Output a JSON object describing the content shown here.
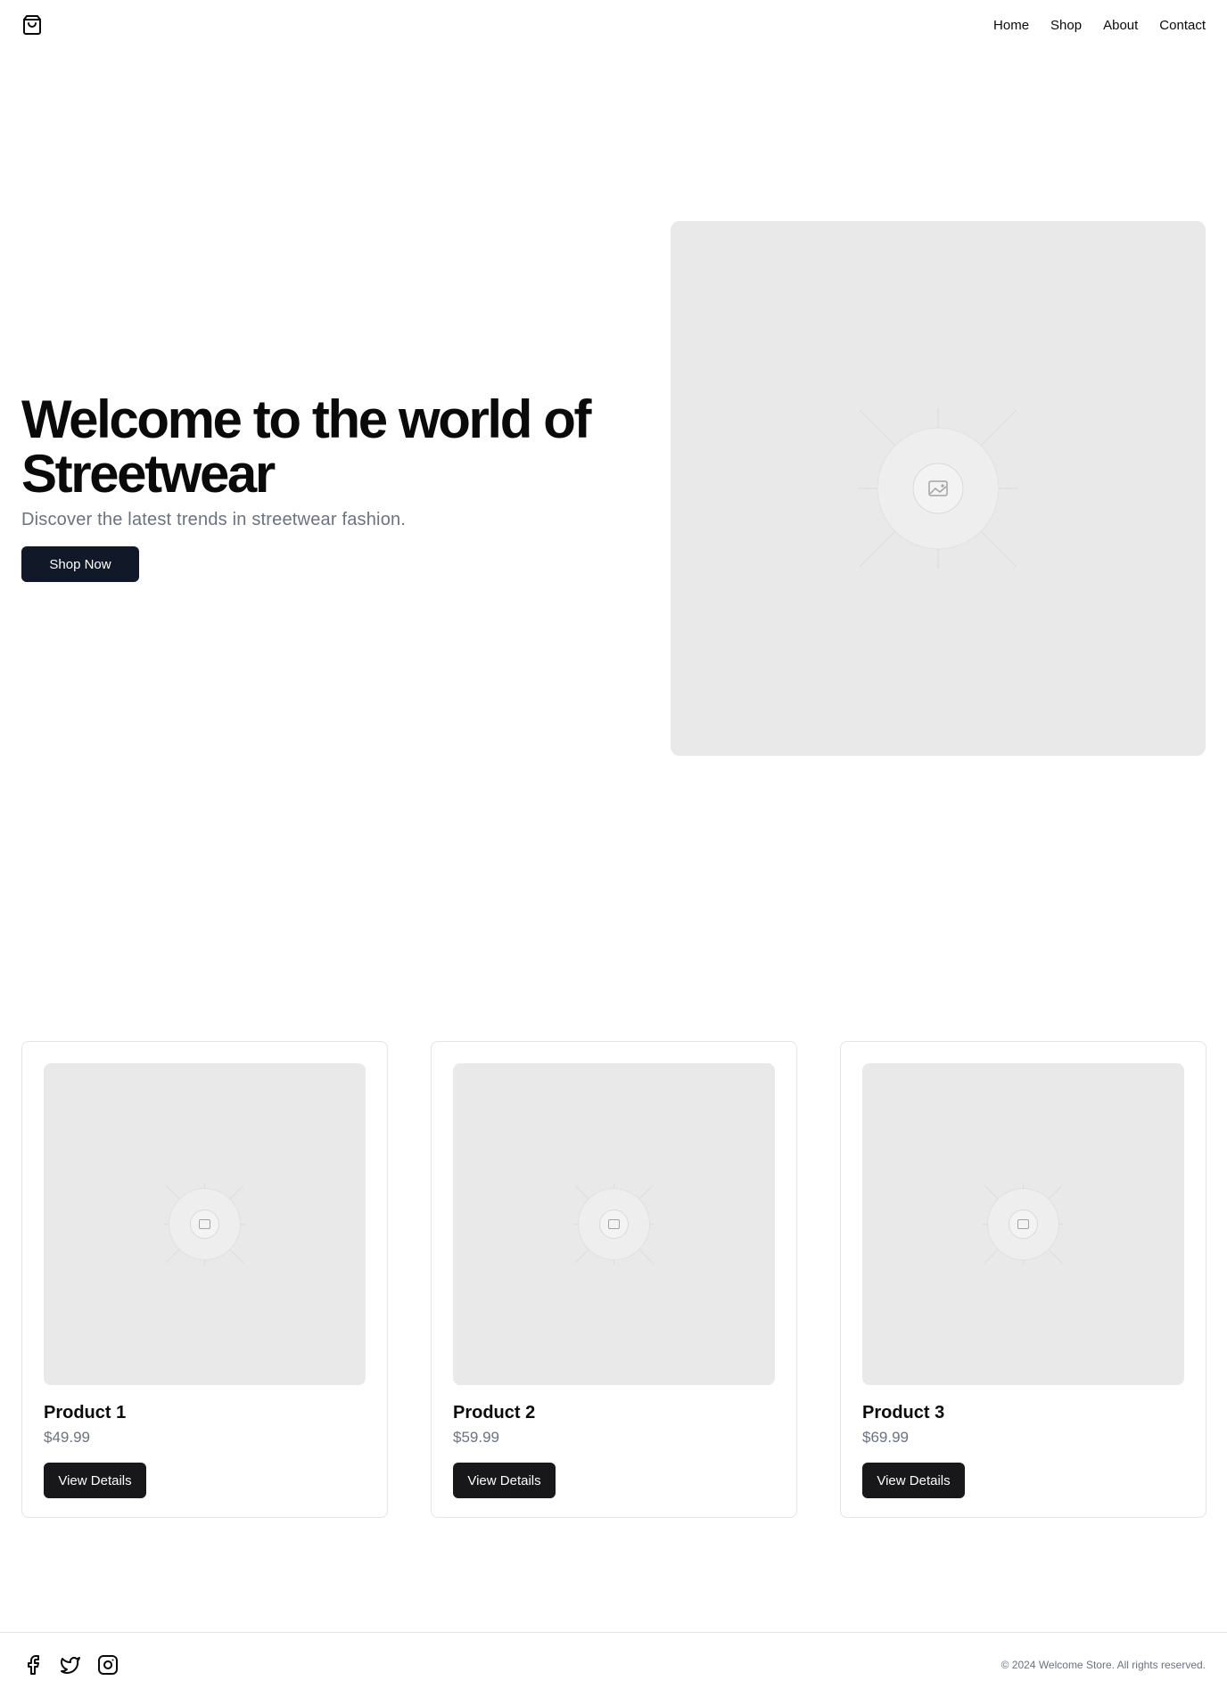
{
  "header": {
    "logo_icon": "shopping-bag-icon",
    "nav": [
      {
        "label": "Home"
      },
      {
        "label": "Shop"
      },
      {
        "label": "About"
      },
      {
        "label": "Contact"
      }
    ]
  },
  "hero": {
    "title_line1": "Welcome to the world of",
    "title_line2": "Streetwear",
    "subtitle": "Discover the latest trends in streetwear fashion.",
    "cta_label": "Shop Now",
    "image_icon": "image-placeholder-icon"
  },
  "products": [
    {
      "name": "Product 1",
      "price": "$49.99",
      "button": "View Details"
    },
    {
      "name": "Product 2",
      "price": "$59.99",
      "button": "View Details"
    },
    {
      "name": "Product 3",
      "price": "$69.99",
      "button": "View Details"
    }
  ],
  "footer": {
    "socials": [
      "facebook-icon",
      "twitter-icon",
      "instagram-icon"
    ],
    "copyright": "© 2024 Welcome Store. All rights reserved."
  },
  "colors": {
    "primary_button": "#111827",
    "dark_button": "#18181b",
    "placeholder_bg": "#e9e9e9",
    "muted_text": "#6b7280"
  }
}
